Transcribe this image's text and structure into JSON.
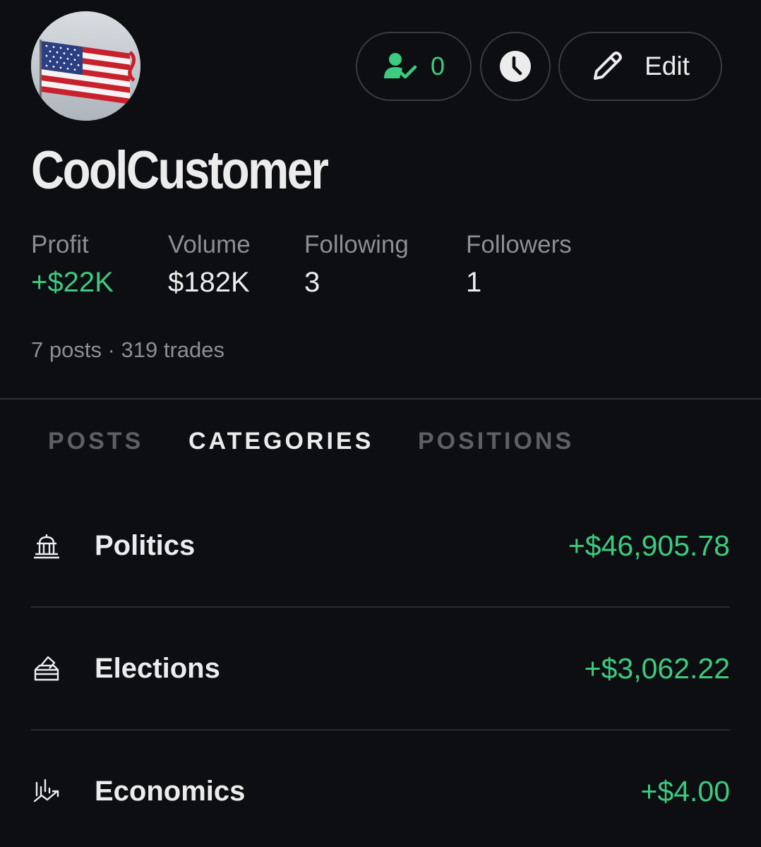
{
  "profile": {
    "username": "CoolCustomer",
    "avatar_icon": "american-flag-avatar"
  },
  "actions": {
    "follow_count": "0",
    "follow_icon": "user-check-icon",
    "history_icon": "clock-icon",
    "edit_label": "Edit",
    "edit_icon": "pencil-icon"
  },
  "stats": [
    {
      "label": "Profit",
      "value": "+$22K"
    },
    {
      "label": "Volume",
      "value": "$182K"
    },
    {
      "label": "Following",
      "value": "3"
    },
    {
      "label": "Followers",
      "value": "1"
    }
  ],
  "meta": "7 posts · 319 trades",
  "tabs": [
    {
      "label": "POSTS",
      "active": false
    },
    {
      "label": "CATEGORIES",
      "active": true
    },
    {
      "label": "POSITIONS",
      "active": false
    }
  ],
  "categories": [
    {
      "name": "Politics",
      "amount": "+$46,905.78",
      "icon": "capitol-icon"
    },
    {
      "name": "Elections",
      "amount": "+$3,062.22",
      "icon": "ballot-box-icon"
    },
    {
      "name": "Economics",
      "amount": "+$4.00",
      "icon": "chart-trend-icon"
    }
  ],
  "colors": {
    "background": "#0d0e12",
    "accent_green": "#3ccb7f",
    "muted_text": "#8d8e94",
    "border": "#3a3b40"
  }
}
